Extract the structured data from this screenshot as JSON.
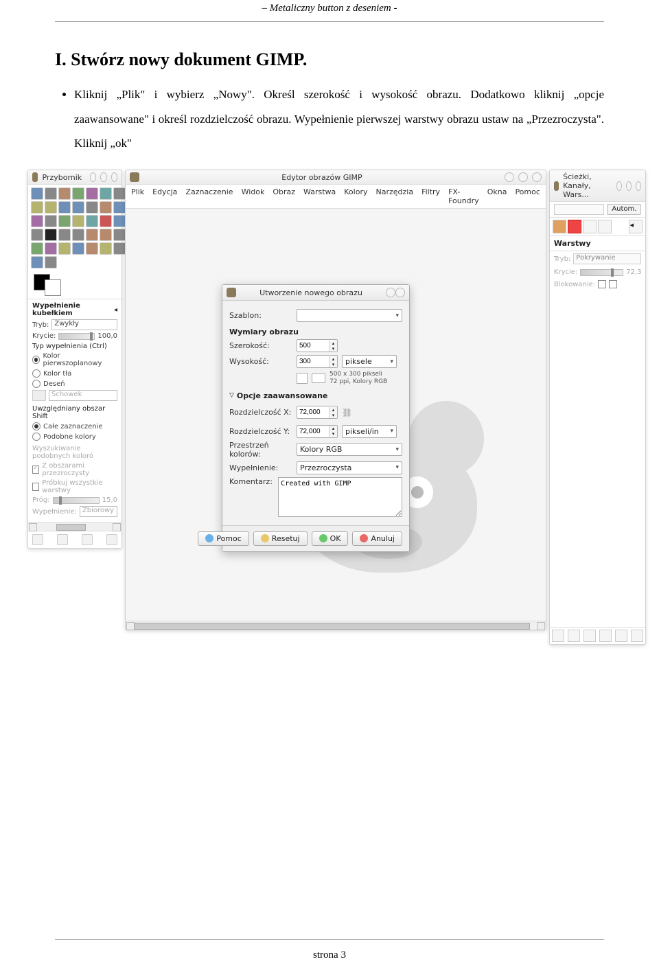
{
  "doc": {
    "header": "Metaliczny button z deseniem -",
    "section_title": "I. Stwórz nowy dokument GIMP.",
    "bullet": "Kliknij „Plik\" i wybierz „Nowy\". Określ szerokość i wysokość obrazu. Dodatkowo kliknij „opcje zaawansowane\" i określ rozdzielczość obrazu. Wypełnienie pierwszej warstwy obrazu ustaw na „Przezroczysta\". Kliknij „ok\"",
    "footer": "strona 3"
  },
  "toolbox": {
    "title": "Przybornik",
    "opt_title": "Wypełnienie kubełkiem",
    "tryb_label": "Tryb:",
    "tryb_value": "Zwykły",
    "krycie_label": "Krycie:",
    "krycie_value": "100,0",
    "fill_type_label": "Typ wypełnienia  (Ctrl)",
    "fill_fg": "Kolor pierwszoplanowy",
    "fill_bg": "Kolor tła",
    "fill_pat": "Deseń",
    "pattern_value": "Schowek",
    "area_label": "Uwzględniany obszar  Shift",
    "area_all": "Całe zaznaczenie",
    "area_similar": "Podobne kolory",
    "find_label": "Wyszukiwanie podobnych koloró",
    "transp": "Z obszarami przezroczysty",
    "all_layers": "Próbkuj wszystkie warstwy",
    "prog_label": "Próg:",
    "prog_value": "15,0",
    "wyp_label": "Wypełnienie:",
    "wyp_value": "Zbiorowy"
  },
  "editor": {
    "title": "Edytor obrazów GIMP",
    "menu": [
      "Plik",
      "Edycja",
      "Zaznaczenie",
      "Widok",
      "Obraz",
      "Warstwa",
      "Kolory",
      "Narzędzia",
      "Filtry",
      "FX-Foundry",
      "Okna",
      "Pomoc"
    ]
  },
  "dialog": {
    "title": "Utworzenie nowego obrazu",
    "szablon": "Szablon:",
    "wymiary": "Wymiary obrazu",
    "szer_label": "Szerokość:",
    "szer_value": "500",
    "wys_label": "Wysokość:",
    "wys_value": "300",
    "unit": "piksele",
    "info1": "500 x 300 pikseli",
    "info2": "72 ppi, Kolory RGB",
    "adv": "Opcje zaawansowane",
    "resx_label": "Rozdzielczość X:",
    "resx_value": "72,000",
    "resy_label": "Rozdzielczość Y:",
    "resy_value": "72,000",
    "resunit": "pikseli/in",
    "space_label": "Przestrzeń kolorów:",
    "space_value": "Kolory RGB",
    "fill_label": "Wypełnienie:",
    "fill_value": "Przezroczysta",
    "comment_label": "Komentarz:",
    "comment_value": "Created with GIMP",
    "btn_help": "Pomoc",
    "btn_reset": "Resetuj",
    "btn_ok": "OK",
    "btn_cancel": "Anuluj"
  },
  "layers": {
    "title": "Ścieżki, Kanały, Wars...",
    "autom": "Autom.",
    "header": "Warstwy",
    "tryb_label": "Tryb:",
    "tryb_value": "Pokrywanie",
    "krycie_label": "Krycie:",
    "krycie_value": "72,3",
    "block_label": "Blokowanie:"
  }
}
